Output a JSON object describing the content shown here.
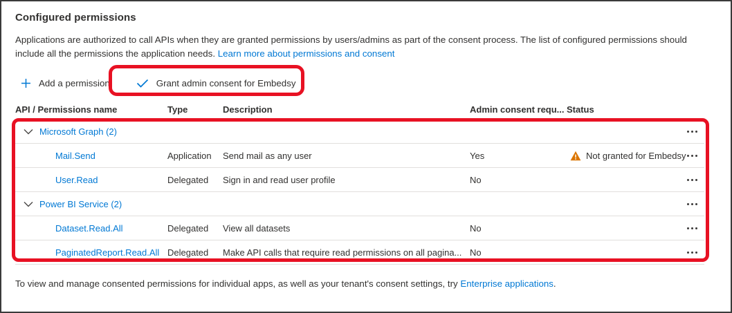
{
  "header": {
    "title": "Configured permissions"
  },
  "intro": {
    "text": "Applications are authorized to call APIs when they are granted permissions by users/admins as part of the consent process. The list of configured permissions should include all the permissions the application needs. ",
    "link": "Learn more about permissions and consent"
  },
  "toolbar": {
    "add_permission": {
      "icon": "plus-icon",
      "label": "Add a permission"
    },
    "grant_admin_consent": {
      "icon": "checkmark-icon",
      "label": "Grant admin consent for Embedsy"
    }
  },
  "table": {
    "columns": [
      "API / Permissions name",
      "Type",
      "Description",
      "Admin consent requ...",
      "Status"
    ],
    "row_menu_icon": "more-horizontal-icon",
    "rows": [
      {
        "kind": "group",
        "name": "Microsoft Graph (2)"
      },
      {
        "kind": "permission",
        "name": "Mail.Send",
        "type": "Application",
        "description": "Send mail as any user",
        "admin_consent": "Yes",
        "status": "Not granted for Embedsy",
        "status_icon": "warning-icon"
      },
      {
        "kind": "permission",
        "name": "User.Read",
        "type": "Delegated",
        "description": "Sign in and read user profile",
        "admin_consent": "No",
        "status": ""
      },
      {
        "kind": "group",
        "name": "Power BI Service (2)"
      },
      {
        "kind": "permission",
        "name": "Dataset.Read.All",
        "type": "Delegated",
        "description": "View all datasets",
        "admin_consent": "No",
        "status": ""
      },
      {
        "kind": "permission",
        "name": "PaginatedReport.Read.All",
        "type": "Delegated",
        "description": "Make API calls that require read permissions on all pagina...",
        "admin_consent": "No",
        "status": ""
      }
    ]
  },
  "footer": {
    "text_before": "To view and manage consented permissions for individual apps, as well as your tenant's consent settings, try ",
    "link": "Enterprise applications",
    "text_after": "."
  },
  "colors": {
    "link_blue": "#0078d4",
    "annotation_red": "#e81123",
    "warning_orange": "#db7500",
    "text_dark": "#323130"
  }
}
